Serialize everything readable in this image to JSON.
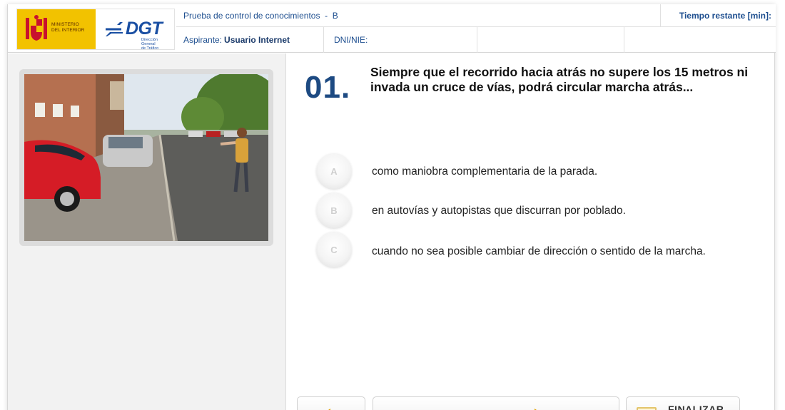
{
  "header": {
    "ministry_lines": [
      "MINISTERIO",
      "DEL INTERIOR"
    ],
    "dgt_logo_text": "DGT",
    "dgt_sub_lines": [
      "Dirección General",
      "de Tráfico"
    ],
    "test_title": "Prueba de control de conocimientos",
    "test_separator": "-",
    "test_version": "B",
    "timer_label": "Tiempo restante [min]:",
    "candidate_label": "Aspirante:",
    "candidate_value": "Usuario Internet",
    "dni_label": "DNI/NIE:"
  },
  "question": {
    "number": "01.",
    "text": "Siempre que el recorrido hacia atrás no supere los 15 metros ni invada un cruce de vías, podrá circular marcha atrás..."
  },
  "answers": [
    {
      "letter": "A",
      "text": "como maniobra complementaria de la parada."
    },
    {
      "letter": "B",
      "text": "en autovías y autopistas que discurran por poblado."
    },
    {
      "letter": "C",
      "text": "cuando no sea posible cambiar de dirección o sentido de la marcha."
    }
  ],
  "navigation": {
    "finish_label": "FINALIZAR"
  },
  "colors": {
    "brand_blue": "#1d4a82",
    "ministry_yellow": "#f2c200",
    "arrow_orange": "#e3a300"
  },
  "icons": {
    "prev": "arrow-left-icon",
    "next": "arrow-right-icon",
    "finish": "finish-icon"
  }
}
